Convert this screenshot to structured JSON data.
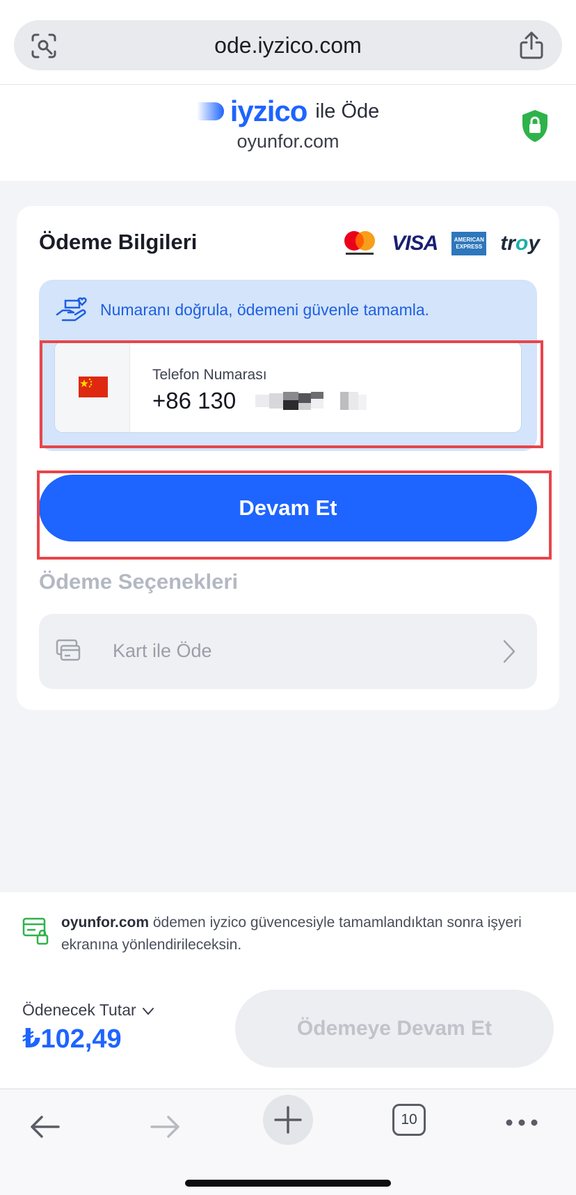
{
  "browser": {
    "url": "ode.iyzico.com",
    "lens_icon": "visual-search-icon",
    "share_icon": "share-icon"
  },
  "header": {
    "brand": "iyzico",
    "brand_suffix": "ile Öde",
    "merchant": "oyunfor.com",
    "security_icon": "shield-lock-icon",
    "brand_color": "#1e64ff"
  },
  "payment": {
    "title": "Ödeme Bilgileri",
    "card_logos": [
      "mastercard",
      "VISA",
      "American Express",
      "troy"
    ],
    "verify_message": "Numaranı doğrula, ödemeni güvenle tamamla.",
    "phone": {
      "label": "Telefon Numarası",
      "value": "+86 130",
      "country_flag": "china-flag-icon"
    },
    "continue_label": "Devam Et",
    "options_title": "Ödeme Seçenekleri",
    "card_option_label": "Kart ile Öde"
  },
  "footer": {
    "merchant": "oyunfor.com",
    "secure_text": " ödemen iyzico güvencesiyle tamamlandıktan sonra işyeri ekranına yönlendirileceksin.",
    "amount_label": "Ödenecek Tutar",
    "amount_value": "₺102,49",
    "pay_button_label": "Ödemeye Devam Et"
  },
  "toolbar": {
    "tab_count": "10"
  },
  "colors": {
    "accent": "#1e64ff",
    "highlight": "#e8454b",
    "verify_bg": "#d3e4fb"
  }
}
